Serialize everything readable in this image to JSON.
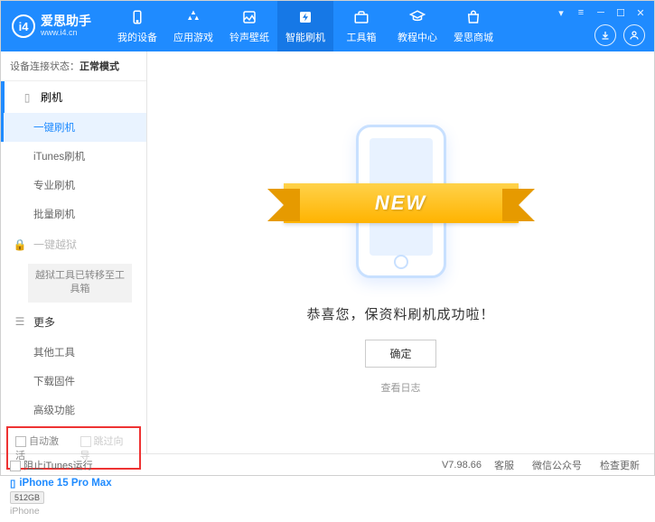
{
  "app": {
    "title": "爱思助手",
    "subtitle": "www.i4.cn"
  },
  "nav": [
    {
      "label": "我的设备"
    },
    {
      "label": "应用游戏"
    },
    {
      "label": "铃声壁纸"
    },
    {
      "label": "智能刷机"
    },
    {
      "label": "工具箱"
    },
    {
      "label": "教程中心"
    },
    {
      "label": "爱思商城"
    }
  ],
  "status": {
    "label": "设备连接状态：",
    "value": "正常模式"
  },
  "sidebar": {
    "flash_header": "刷机",
    "items": [
      {
        "label": "一键刷机"
      },
      {
        "label": "iTunes刷机"
      },
      {
        "label": "专业刷机"
      },
      {
        "label": "批量刷机"
      }
    ],
    "jailbreak_header": "一键越狱",
    "jailbreak_note": "越狱工具已转移至工具箱",
    "more_header": "更多",
    "more_items": [
      {
        "label": "其他工具"
      },
      {
        "label": "下载固件"
      },
      {
        "label": "高级功能"
      }
    ],
    "auto_activate": "自动激活",
    "skip_guide": "跳过向导"
  },
  "device": {
    "name": "iPhone 15 Pro Max",
    "storage": "512GB",
    "type": "iPhone"
  },
  "main": {
    "ribbon": "NEW",
    "success": "恭喜您，保资料刷机成功啦！",
    "ok": "确定",
    "log": "查看日志"
  },
  "footer": {
    "block_itunes": "阻止iTunes运行",
    "version": "V7.98.66",
    "links": [
      "客服",
      "微信公众号",
      "检查更新"
    ]
  }
}
